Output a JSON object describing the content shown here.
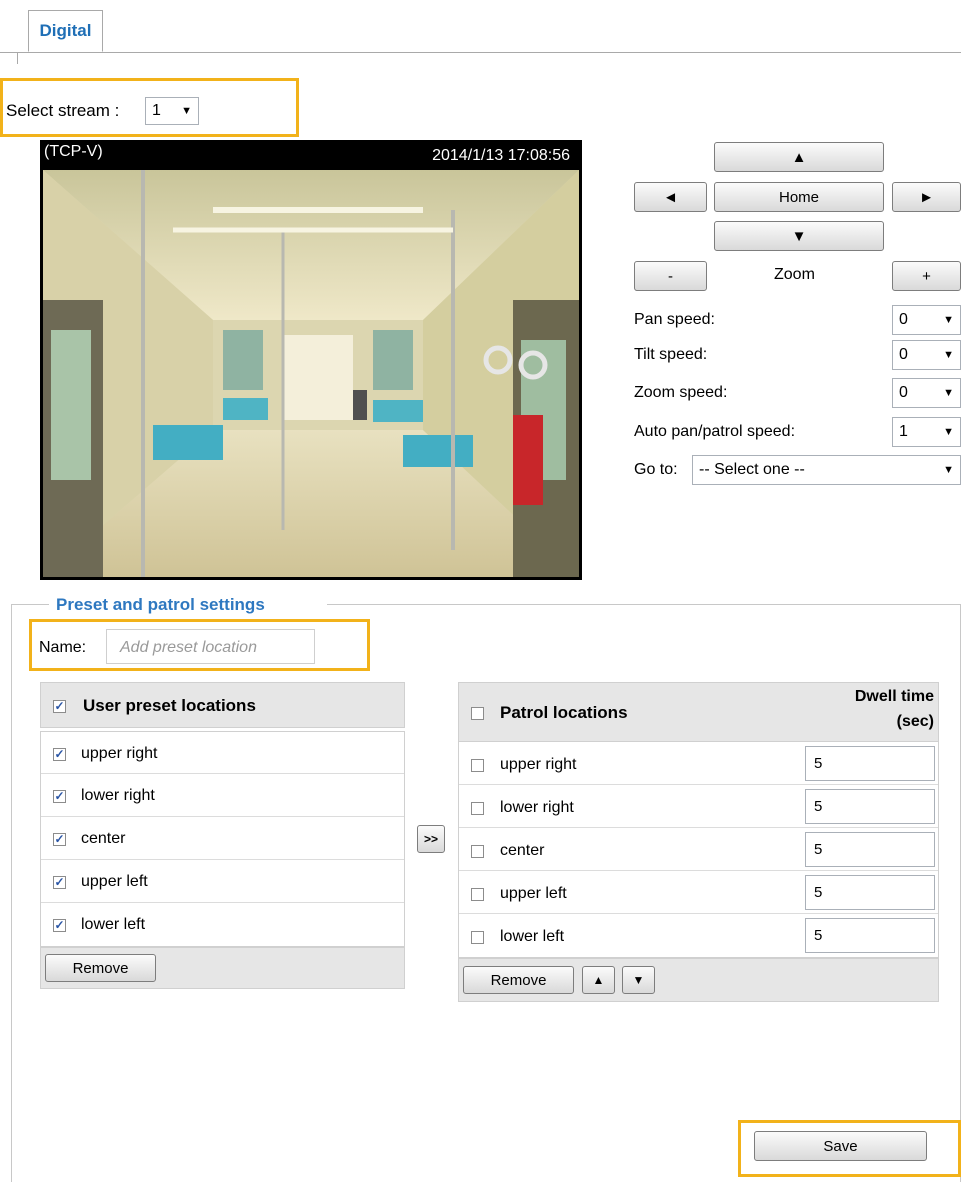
{
  "tab": {
    "label": "Digital"
  },
  "stream": {
    "label": "Select stream :",
    "value": "1"
  },
  "video": {
    "mode": "(TCP-V)",
    "timestamp": "2014/1/13  17:08:56"
  },
  "ptz": {
    "up": "▲",
    "down": "▼",
    "left": "◄",
    "right": "►",
    "home": "Home",
    "zoom_out": "-",
    "zoom_in": "+",
    "zoom_label": "Zoom"
  },
  "speeds": {
    "pan_label": "Pan speed:",
    "pan_value": "0",
    "tilt_label": "Tilt speed:",
    "tilt_value": "0",
    "zoom_label": "Zoom speed:",
    "zoom_value": "0",
    "auto_label": "Auto pan/patrol speed:",
    "auto_value": "1",
    "goto_label": "Go to:",
    "goto_value": "-- Select one --"
  },
  "preset": {
    "legend": "Preset and patrol settings",
    "name_label": "Name:",
    "name_placeholder": "Add preset location",
    "user_header": "User preset locations",
    "user_items": [
      "upper right",
      "lower right",
      "center",
      "upper left",
      "lower left"
    ],
    "remove_label": "Remove",
    "add_label": ">>",
    "patrol_header": "Patrol locations",
    "dwell_header_1": "Dwell time",
    "dwell_header_2": "(sec)",
    "patrol_items": [
      {
        "name": "upper right",
        "dwell": "5"
      },
      {
        "name": "lower right",
        "dwell": "5"
      },
      {
        "name": "center",
        "dwell": "5"
      },
      {
        "name": "upper left",
        "dwell": "5"
      },
      {
        "name": "lower left",
        "dwell": "5"
      }
    ],
    "patrol_remove_label": "Remove",
    "move_up": "▲",
    "move_down": "▼",
    "checkmark": "✓"
  },
  "save_label": "Save",
  "colors": {
    "highlight": "#f2b21a",
    "legend": "#2e78c0",
    "tab": "#1f6fb6"
  }
}
